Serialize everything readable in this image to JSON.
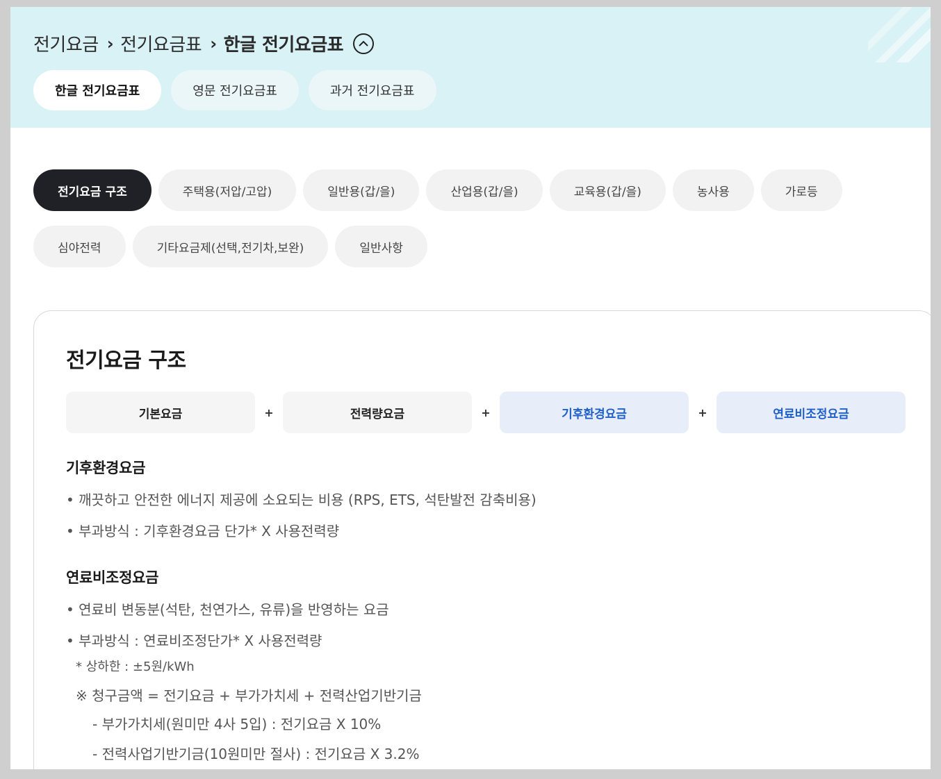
{
  "breadcrumb": {
    "items": [
      "전기요금",
      "전기요금표"
    ],
    "current": "한글 전기요금표",
    "separator": "›"
  },
  "lang_tabs": [
    "한글 전기요금표",
    "영문 전기요금표",
    "과거 전기요금표"
  ],
  "categories": [
    "전기요금 구조",
    "주택용(저압/고압)",
    "일반용(갑/을)",
    "산업용(갑/을)",
    "교육용(갑/을)",
    "농사용",
    "가로등",
    "심야전력",
    "기타요금제(선택,전기차,보완)",
    "일반사항"
  ],
  "card": {
    "title": "전기요금 구조",
    "formula": {
      "items": [
        "기본요금",
        "전력량요금",
        "기후환경요금",
        "연료비조정요금"
      ],
      "plus": "+"
    },
    "climate": {
      "title": "기후환경요금",
      "bullets": [
        "• 깨끗하고 안전한 에너지 제공에 소요되는 비용 (RPS, ETS, 석탄발전 감축비용)",
        "• 부과방식 : 기후환경요금 단가* X 사용전력량"
      ]
    },
    "fuel": {
      "title": "연료비조정요금",
      "bullets": [
        "• 연료비 변동분(석탄, 천연가스, 유류)을 반영하는 요금",
        "• 부과방식 : 연료비조정단가* X 사용전력량"
      ],
      "note": "* 상하한 : ±5원/kWh",
      "notice": "※ 청구금액 = 전기요금 + 부가가치세 + 전력산업기반기금",
      "subnotes": [
        "- 부가가치세(원미만 4사 5입) : 전기요금 X 10%",
        "- 전력사업기반기금(10원미만 절사) : 전기요금 X 3.2%"
      ]
    }
  },
  "colors": {
    "hero_bg": "#d9f2f6",
    "active_category_bg": "#1f2127",
    "highlight_box_bg": "#e7eefa",
    "highlight_text": "#1f5fc9"
  }
}
